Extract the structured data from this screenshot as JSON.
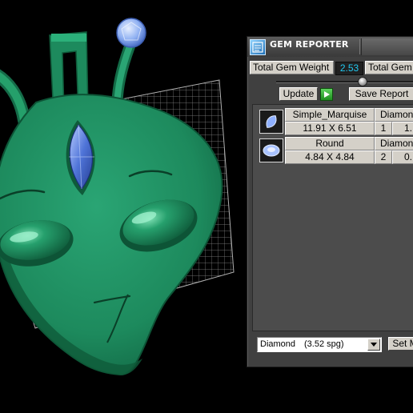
{
  "panel": {
    "title": "GEM REPORTER",
    "total_gem_weight_label": "Total Gem Weight",
    "total_gem_weight_value": "2.53",
    "total_gem_count_label": "Total Gem",
    "update_label": "Update",
    "save_report_label": "Save Report"
  },
  "gems": [
    {
      "shape": "Simple_Marquise",
      "size": "11.91 X 6.51",
      "material": "Diamond",
      "count": "1",
      "weight": "1."
    },
    {
      "shape": "Round",
      "size": "4.84 X 4.84",
      "material": "Diamond",
      "count": "2",
      "weight": "0."
    }
  ],
  "material_select": {
    "name": "Diamond",
    "density": "(3.52 spg)"
  },
  "set_material_label": "Set M",
  "colors": {
    "model_green": "#1f8a5e",
    "gem_blue": "#5b7fe0",
    "panel_bg": "#404040",
    "value_cyan": "#21c8f0"
  },
  "icons": [
    "gem-reporter-icon",
    "play-icon",
    "marquise-gem-icon",
    "round-gem-icon",
    "dropdown-arrow-icon"
  ]
}
